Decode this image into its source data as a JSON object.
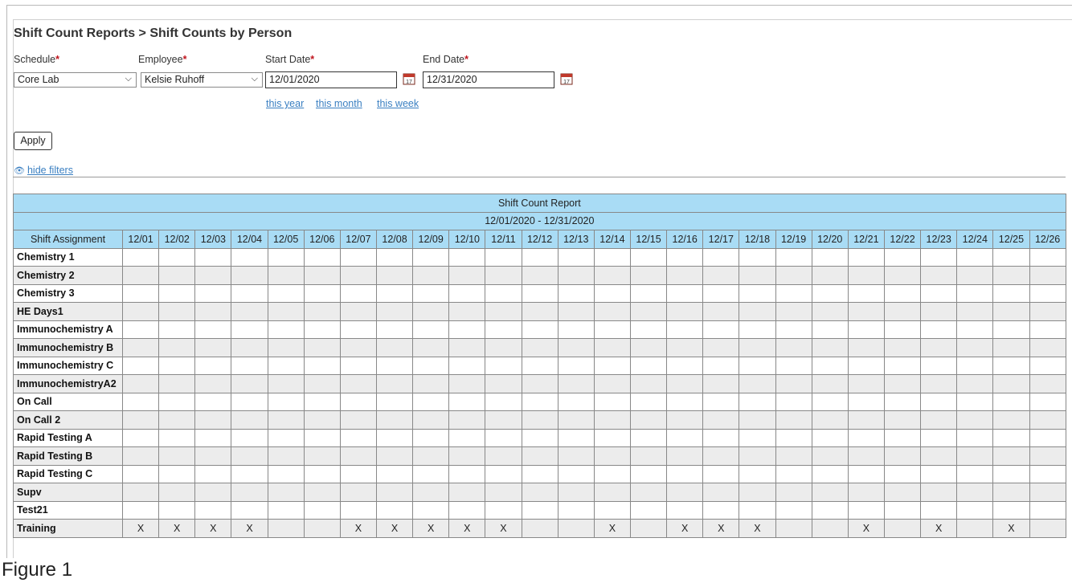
{
  "page": {
    "breadcrumb": "Shift Count Reports > Shift Counts by Person",
    "caption": "Figure 1"
  },
  "filters": {
    "schedule": {
      "label": "Schedule",
      "value": "Core Lab"
    },
    "employee": {
      "label": "Employee",
      "value": "Kelsie Ruhoff"
    },
    "start_date": {
      "label": "Start Date",
      "value": "12/01/2020"
    },
    "end_date": {
      "label": "End Date",
      "value": "12/31/2020"
    },
    "required_mark": "*",
    "calendar_icon_text": "17",
    "quick_links": [
      "this year",
      "this month",
      "this week"
    ],
    "apply_label": "Apply",
    "hide_filters_label": "hide filters"
  },
  "report": {
    "title": "Shift Count Report",
    "range": "12/01/2020 - 12/31/2020",
    "first_col_header": "Shift Assignment",
    "dates": [
      "12/01",
      "12/02",
      "12/03",
      "12/04",
      "12/05",
      "12/06",
      "12/07",
      "12/08",
      "12/09",
      "12/10",
      "12/11",
      "12/12",
      "12/13",
      "12/14",
      "12/15",
      "12/16",
      "12/17",
      "12/18",
      "12/19",
      "12/20",
      "12/21",
      "12/22",
      "12/23",
      "12/24",
      "12/25",
      "12/26"
    ],
    "mark": "X",
    "rows": [
      {
        "name": "Chemistry 1",
        "marks": []
      },
      {
        "name": "Chemistry 2",
        "marks": []
      },
      {
        "name": "Chemistry 3",
        "marks": []
      },
      {
        "name": "HE Days1",
        "marks": []
      },
      {
        "name": "Immunochemistry A",
        "marks": []
      },
      {
        "name": "Immunochemistry B",
        "marks": []
      },
      {
        "name": "Immunochemistry C",
        "marks": []
      },
      {
        "name": "ImmunochemistryA2",
        "marks": []
      },
      {
        "name": "On Call",
        "marks": []
      },
      {
        "name": "On Call 2",
        "marks": []
      },
      {
        "name": "Rapid Testing A",
        "marks": []
      },
      {
        "name": "Rapid Testing B",
        "marks": []
      },
      {
        "name": "Rapid Testing C",
        "marks": []
      },
      {
        "name": "Supv",
        "marks": []
      },
      {
        "name": "Test21",
        "marks": []
      },
      {
        "name": "Training",
        "marks": [
          "12/01",
          "12/02",
          "12/03",
          "12/04",
          "12/07",
          "12/08",
          "12/09",
          "12/10",
          "12/11",
          "12/14",
          "12/16",
          "12/17",
          "12/18",
          "12/21",
          "12/23",
          "12/25"
        ]
      }
    ]
  }
}
